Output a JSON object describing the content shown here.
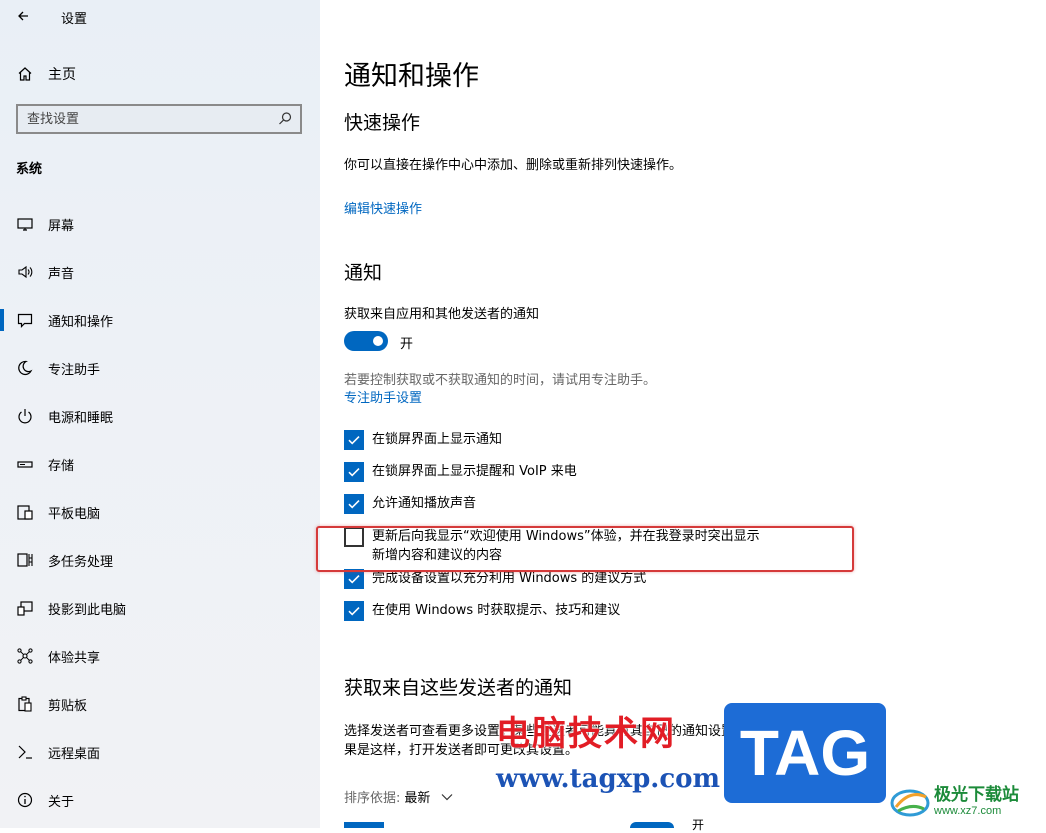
{
  "window": {
    "title": "设置"
  },
  "sidebar": {
    "home_label": "主页",
    "search_placeholder": "查找设置",
    "section_label": "系统",
    "items": [
      {
        "label": "屏幕",
        "icon": "monitor-icon"
      },
      {
        "label": "声音",
        "icon": "speaker-icon"
      },
      {
        "label": "通知和操作",
        "icon": "notification-icon",
        "active": true
      },
      {
        "label": "专注助手",
        "icon": "moon-icon"
      },
      {
        "label": "电源和睡眠",
        "icon": "power-icon"
      },
      {
        "label": "存储",
        "icon": "storage-icon"
      },
      {
        "label": "平板电脑",
        "icon": "tablet-icon"
      },
      {
        "label": "多任务处理",
        "icon": "multitask-icon"
      },
      {
        "label": "投影到此电脑",
        "icon": "project-icon"
      },
      {
        "label": "体验共享",
        "icon": "share-icon"
      },
      {
        "label": "剪贴板",
        "icon": "clipboard-icon"
      },
      {
        "label": "远程桌面",
        "icon": "remote-icon"
      },
      {
        "label": "关于",
        "icon": "info-icon"
      }
    ]
  },
  "main": {
    "title": "通知和操作",
    "quick": {
      "heading": "快速操作",
      "description": "你可以直接在操作中心中添加、删除或重新排列快速操作。",
      "edit_link": "编辑快速操作"
    },
    "notifications": {
      "heading": "通知",
      "toggle_title": "获取来自应用和其他发送者的通知",
      "toggle_state": "开",
      "toggle_on": true,
      "hint": "若要控制获取或不获取通知的时间，请试用专注助手。",
      "focus_link": "专注助手设置",
      "checkboxes": [
        {
          "label": "在锁屏界面上显示通知",
          "checked": true
        },
        {
          "label": "在锁屏界面上显示提醒和 VoIP 来电",
          "checked": true
        },
        {
          "label": "允许通知播放声音",
          "checked": true
        },
        {
          "label": "更新后向我显示“欢迎使用 Windows”体验，并在我登录时突出显示",
          "label2": "新增内容和建议的内容",
          "checked": false
        },
        {
          "label": "完成设备设置以充分利用 Windows 的建议方式",
          "checked": true
        },
        {
          "label": "在使用 Windows 时获取提示、技巧和建议",
          "checked": true
        }
      ]
    },
    "senders": {
      "heading": "获取来自这些发送者的通知",
      "desc_line1": "选择发送者可查看更多设置。某些发送者可能具有其自己的通知设置。如",
      "desc_line2": "果是这样，打开发送者即可更改其设置。",
      "sort_label": "排序依据:",
      "sort_value": "最新",
      "partial_item": "开"
    }
  },
  "watermark": {
    "cn_text": "电脑技术网",
    "url": "www.tagxp.com",
    "tag": "TAG",
    "site_name": "极光下载站",
    "site_url": "www.xz7.com"
  },
  "colors": {
    "accent": "#0067c0",
    "highlight_box": "#d53a3a",
    "watermark_red": "#e21d25",
    "watermark_blue": "#1c53b5"
  }
}
